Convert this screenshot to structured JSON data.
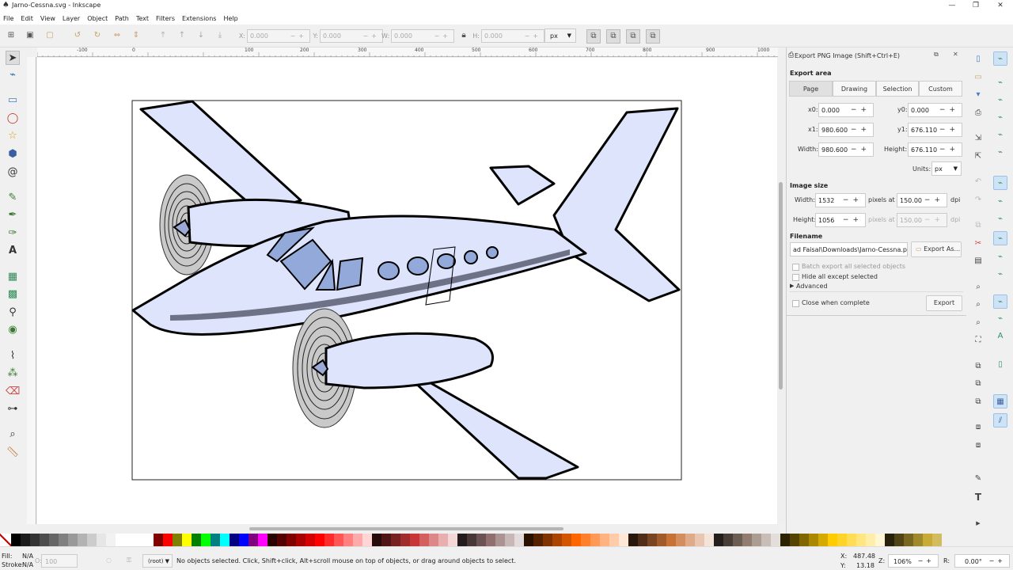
{
  "window": {
    "title": "Jarno-Cessna.svg - Inkscape",
    "minimize": "—",
    "maximize": "❐",
    "close": "✕"
  },
  "menu": [
    "File",
    "Edit",
    "View",
    "Layer",
    "Object",
    "Path",
    "Text",
    "Filters",
    "Extensions",
    "Help"
  ],
  "controls": {
    "x_label": "X:",
    "x_value": "0.000",
    "y_label": "Y:",
    "y_value": "0.000",
    "w_label": "W:",
    "w_value": "0.000",
    "h_label": "H:",
    "h_value": "0.000",
    "units": "px"
  },
  "ruler_ticks": [
    "-100",
    "0",
    "100",
    "200",
    "300",
    "400",
    "500",
    "600",
    "700",
    "800",
    "900",
    "1000"
  ],
  "export_panel": {
    "title": "Export PNG Image (Shift+Ctrl+E)",
    "export_area_label": "Export area",
    "tabs": [
      "Page",
      "Drawing",
      "Selection",
      "Custom"
    ],
    "active_tab": "Page",
    "x0_label": "x0:",
    "x0": "0.000",
    "y0_label": "y0:",
    "y0": "0.000",
    "x1_label": "x1:",
    "x1": "980.600",
    "y1_label": "y1:",
    "y1": "676.110",
    "width_label": "Width:",
    "width": "980.600",
    "height_label": "Height:",
    "height": "676.110",
    "units_label": "Units:",
    "units": "px",
    "image_size_label": "Image size",
    "img_width_label": "Width:",
    "img_width": "1532",
    "img_height_label": "Height:",
    "img_height": "1056",
    "pixels_at": "pixels at",
    "dpi_value": "150.00",
    "dpi_value_disabled": "150.00",
    "dpi": "dpi",
    "filename_label": "Filename",
    "filename": "ad Faisal\\Downloads\\Jarno-Cessna.png",
    "export_as": "Export As...",
    "batch_export": "Batch export all selected objects",
    "hide_except": "Hide all except selected",
    "advanced": "Advanced",
    "close_when_complete": "Close when complete",
    "export": "Export"
  },
  "palette": [
    "#000000",
    "#1a1a1a",
    "#333333",
    "#4d4d4d",
    "#666666",
    "#808080",
    "#999999",
    "#b3b3b3",
    "#cccccc",
    "#e6e6e6",
    "#f2f2f2",
    "#ffffff",
    "#ffffff",
    "#ffffff",
    "#ffffff",
    "#800000",
    "#ff0000",
    "#808000",
    "#ffff00",
    "#008000",
    "#00ff00",
    "#008080",
    "#00ffff",
    "#000080",
    "#0000ff",
    "#800080",
    "#ff00ff",
    "#2b0000",
    "#550000",
    "#800000",
    "#aa0000",
    "#d40000",
    "#ff0000",
    "#ff2a2a",
    "#ff5555",
    "#ff8080",
    "#ffaaaa",
    "#ffd5d5",
    "#280b0b",
    "#501616",
    "#782121",
    "#a02c2c",
    "#c83737",
    "#d35f5f",
    "#de8787",
    "#e9afaf",
    "#f4d7d7",
    "#241c1c",
    "#483737",
    "#6c5353",
    "#916f6f",
    "#ac9393",
    "#c8b7b7",
    "#e3dbdb",
    "#2b1100",
    "#552200",
    "#803300",
    "#aa4400",
    "#d45500",
    "#ff6600",
    "#ff7f2a",
    "#ff9955",
    "#ffb380",
    "#ffccaa",
    "#ffe6d5",
    "#28170b",
    "#502d16",
    "#784421",
    "#a05a2c",
    "#c87137",
    "#d38d5f",
    "#deaa87",
    "#e9c6af",
    "#f4e3d7",
    "#241f1c",
    "#483e37",
    "#6c5d53",
    "#917c6f",
    "#ac9d93",
    "#c8beb7",
    "#e3dedb",
    "#2b2200",
    "#554400",
    "#806600",
    "#aa8800",
    "#d4aa00",
    "#ffcc00",
    "#ffd42a",
    "#ffdd55",
    "#ffe680",
    "#ffeeaa",
    "#fff6d5",
    "#28220b",
    "#504416",
    "#786721",
    "#a0892c",
    "#c8ab37",
    "#d3bc5f"
  ],
  "status": {
    "fill_label": "Fill:",
    "fill_value": "N/A",
    "stroke_label": "Stroke:",
    "stroke_value": "N/A",
    "opacity_label": "O:",
    "opacity_value": "100",
    "layer": "(root)",
    "message": "No objects selected. Click, Shift+click, Alt+scroll mouse on top of objects, or drag around objects to select.",
    "x_label": "X:",
    "x_value": "487.48",
    "y_label": "Y:",
    "y_value": "13.18",
    "zoom_label": "Z:",
    "zoom_value": "106%",
    "rotate_label": "R:",
    "rotate_value": "0.00°"
  },
  "icons": {
    "tools": [
      "selector-icon",
      "node-icon",
      "rect-icon",
      "circle-icon",
      "star-icon",
      "3dbox-icon",
      "spiral-icon",
      "pencil-icon",
      "pen-icon",
      "calligraphy-icon",
      "text-icon",
      "gradient-icon",
      "mesh-icon",
      "dropper-icon",
      "paint-bucket-icon",
      "tweak-icon",
      "spray-icon",
      "eraser-icon",
      "connector-icon",
      "zoom-icon",
      "measure-icon"
    ]
  }
}
